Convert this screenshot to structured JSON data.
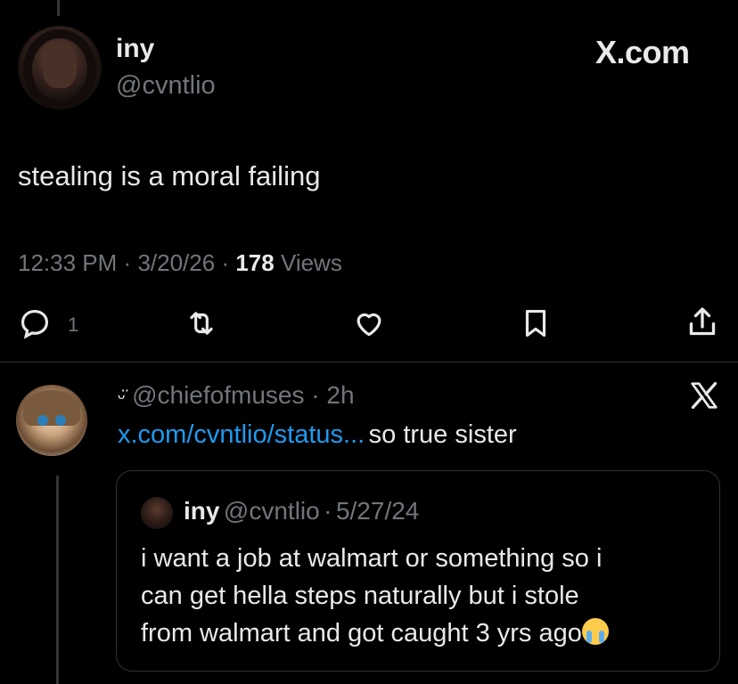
{
  "tweet": {
    "author_name": "iny",
    "author_handle": "@cvntlio",
    "brand": "X.com",
    "text": "stealing is a moral failing",
    "time": "12:33 PM",
    "sep1": "·",
    "date": "3/20/26",
    "sep2": "·",
    "views_count": "178",
    "views_label": "Views",
    "reply_count": "1"
  },
  "reply": {
    "emoji_prefix": "ᵕ̈",
    "handle": "@chiefofmuses",
    "sep": "·",
    "age": "2h",
    "link_text": "x.com/cvntlio/status...",
    "text": "so true sister"
  },
  "quote": {
    "name": "iny",
    "handle": "@cvntlio",
    "sep": "·",
    "date": "5/27/24",
    "line1": "i want a job at walmart or something so i",
    "line2": "can get hella steps naturally but i stole",
    "line3": "from walmart and got caught 3 yrs ago",
    "emoji": "crying-face-emoji"
  },
  "icons": [
    "reply-icon",
    "retweet-icon",
    "like-icon",
    "bookmark-icon",
    "share-icon",
    "x-logo-icon"
  ]
}
